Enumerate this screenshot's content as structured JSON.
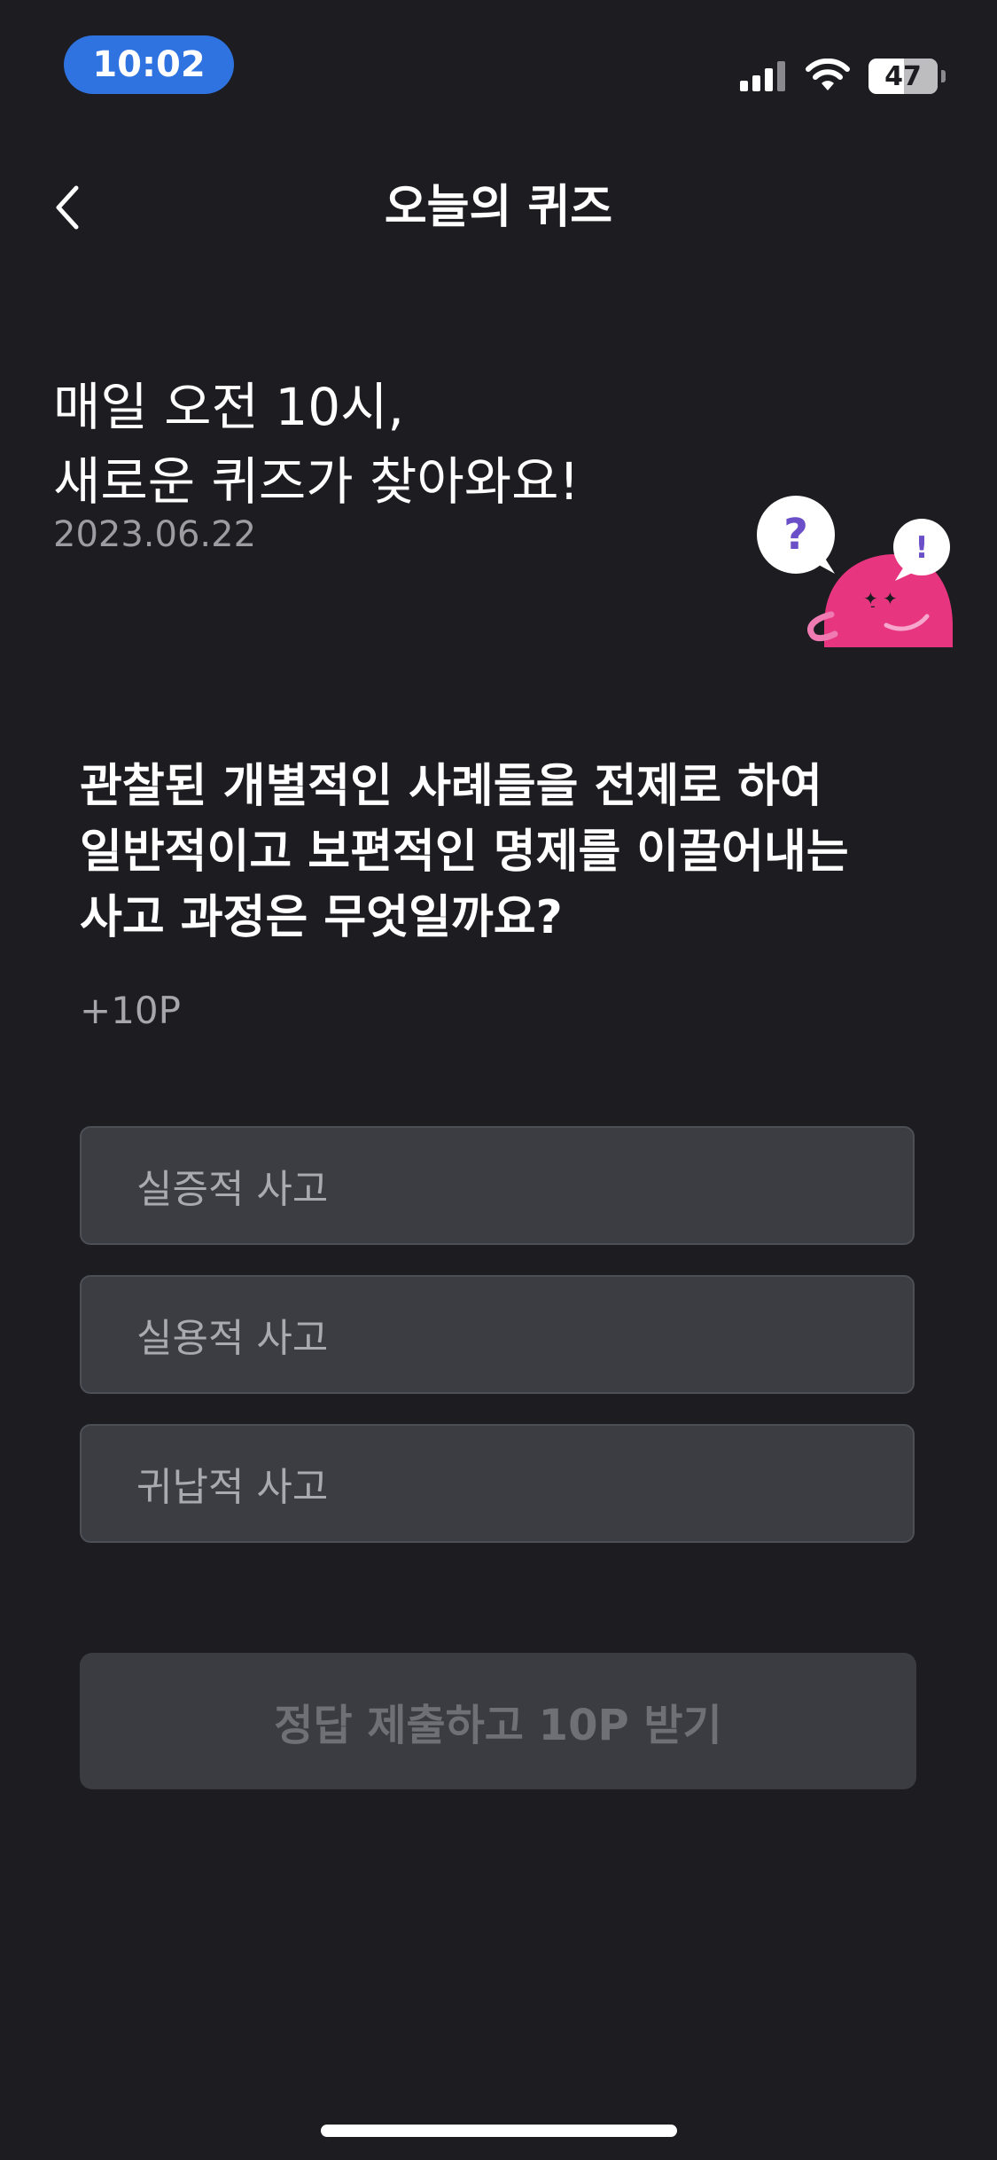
{
  "status_bar": {
    "time": "10:02",
    "battery_level": "47",
    "icons": [
      "cellular-signal-icon",
      "wifi-icon",
      "battery-icon"
    ]
  },
  "nav": {
    "back_icon": "chevron-left-icon",
    "title": "오늘의 퀴즈"
  },
  "intro": {
    "line1": "매일 오전 10시,",
    "line2": "새로운 퀴즈가 찾아와요!",
    "date": "2023.06.22",
    "mascot": {
      "bubble_question": "?",
      "bubble_exclaim": "!"
    }
  },
  "quiz": {
    "question": "관찰된 개별적인 사례들을 전제로 하여 일반적이고 보편적인 명제를 이끌어내는 사고 과정은 무엇일까요?",
    "reward": "+10P",
    "options": [
      {
        "label": "실증적 사고"
      },
      {
        "label": "실용적 사고"
      },
      {
        "label": "귀납적 사고"
      }
    ],
    "submit_label": "정답 제출하고 10P 받기"
  },
  "colors": {
    "background": "#1c1c21",
    "time_pill": "#2f73e0",
    "option_bg": "#3b3d43",
    "submit_bg": "#3a3c42",
    "mascot_pink": "#e8357f",
    "mascot_purple": "#6b4fc8"
  }
}
